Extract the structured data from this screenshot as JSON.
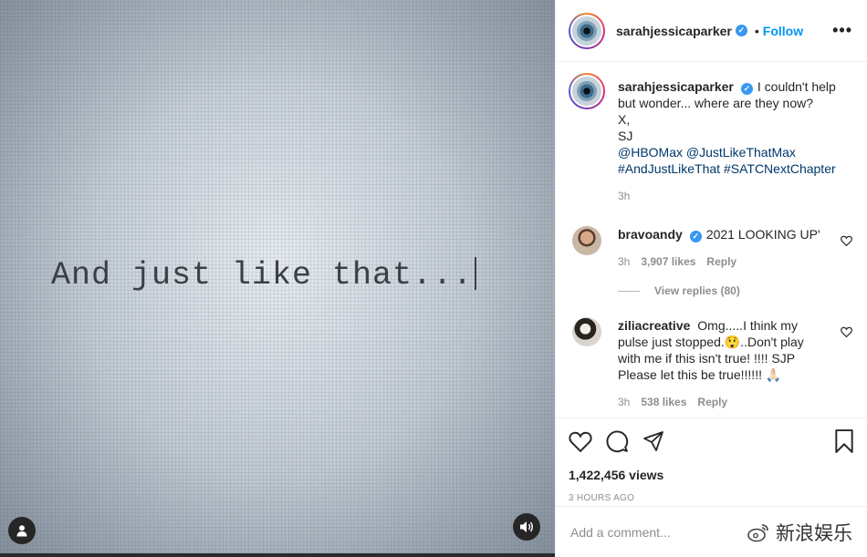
{
  "media": {
    "typed_text": "And just like that...",
    "user_icon": "user-silhouette-icon",
    "audio_icon": "speaker-icon"
  },
  "header": {
    "username": "sarahjessicaparker",
    "separator": "•",
    "follow_label": "Follow",
    "more_label": "•••"
  },
  "caption": {
    "username": "sarahjessicaparker",
    "text_line1": "I couldn't help but wonder... where are they now?",
    "text_line2": "X,",
    "text_line3": "SJ",
    "mention1": "@HBOMax",
    "mention2": "@JustLikeThatMax",
    "hashtag1": "#AndJustLikeThat",
    "hashtag2": "#SATCNextChapter",
    "time": "3h"
  },
  "comments": [
    {
      "username": "bravoandy",
      "text": "2021 LOOKING UP'",
      "time": "3h",
      "likes": "3,907 likes",
      "reply": "Reply",
      "view_replies": "View replies (80)"
    },
    {
      "username": "ziliacreative",
      "text": "Omg.....I think my pulse just stopped.😲..Don't play with me if this isn't true! !!!! SJP Please let this be true!!!!!! 🙏🏻",
      "time": "3h",
      "likes": "538 likes",
      "reply": "Reply"
    }
  ],
  "actions": {
    "views": "1,422,456 views",
    "age": "3 HOURS AGO"
  },
  "add_comment": {
    "placeholder": "Add a comment..."
  },
  "watermark": {
    "text": "新浪娱乐"
  },
  "colors": {
    "link": "#00376b",
    "follow": "#0095f6",
    "verified": "#3897f0",
    "muted": "#8e8e8e"
  }
}
